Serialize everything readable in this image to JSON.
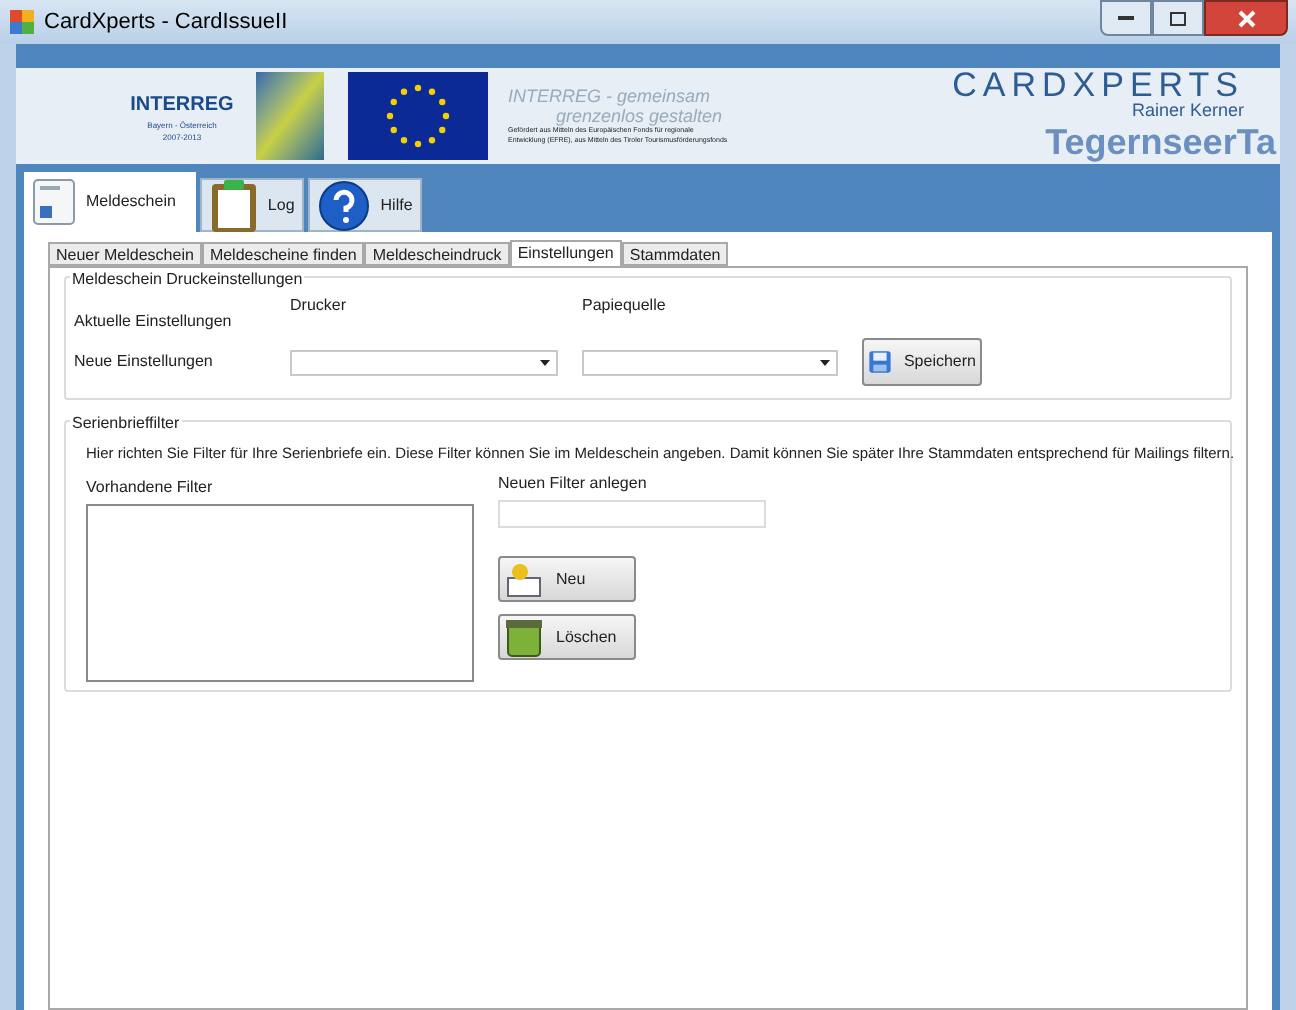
{
  "window": {
    "title": "CardXperts - CardIssueII"
  },
  "banner": {
    "interreg_title": "INTERREG",
    "interreg_region": "Bayern - Österreich",
    "interreg_years": "2007-2013",
    "slogan": [
      "INTERREG - gemeinsam",
      "grenzenlos gestalten"
    ],
    "funding_note": [
      "Gefördert aus Mitteln des Europäischen Fonds für regionale",
      "Entwicklung (EFRE), aus Mitteln des Tiroler Tourismusförderungsfonds"
    ],
    "brand": "CARDXPERTS",
    "brand_sub": "Rainer Kerner",
    "venue": "TegernseerTa"
  },
  "main_tabs": [
    {
      "label": "Meldeschein",
      "kind": "form",
      "selected": true
    },
    {
      "label": "Log",
      "kind": "clipboard",
      "selected": false
    },
    {
      "label": "Hilfe",
      "kind": "help",
      "selected": false
    }
  ],
  "sub_tabs": [
    {
      "label": "Neuer Meldeschein",
      "selected": false
    },
    {
      "label": "Meldescheine finden",
      "selected": false
    },
    {
      "label": "Meldescheindruck",
      "selected": false
    },
    {
      "label": "Einstellungen",
      "selected": true
    },
    {
      "label": "Stammdaten",
      "selected": false
    }
  ],
  "print_settings": {
    "title": "Meldeschein Druckeinstellungen",
    "columns": [
      "Drucker",
      "Papiequelle"
    ],
    "current_label": "Aktuelle Einstellungen",
    "new_label": "Neue Einstellungen",
    "save_button": "Speichern"
  },
  "filter": {
    "title": "Serienbrieffilter",
    "description": "Hier richten Sie Filter für Ihre Serienbriefe ein. Diese Filter können Sie im Meldeschein angeben. Damit können Sie später Ihre Stammdaten entsprechend für Mailings filtern.",
    "existing_label": "Vorhandene Filter",
    "new_label": "Neuen Filter anlegen",
    "buttons": [
      {
        "label": "Neu",
        "kind": "new"
      },
      {
        "label": "Löschen",
        "kind": "delete"
      }
    ]
  }
}
